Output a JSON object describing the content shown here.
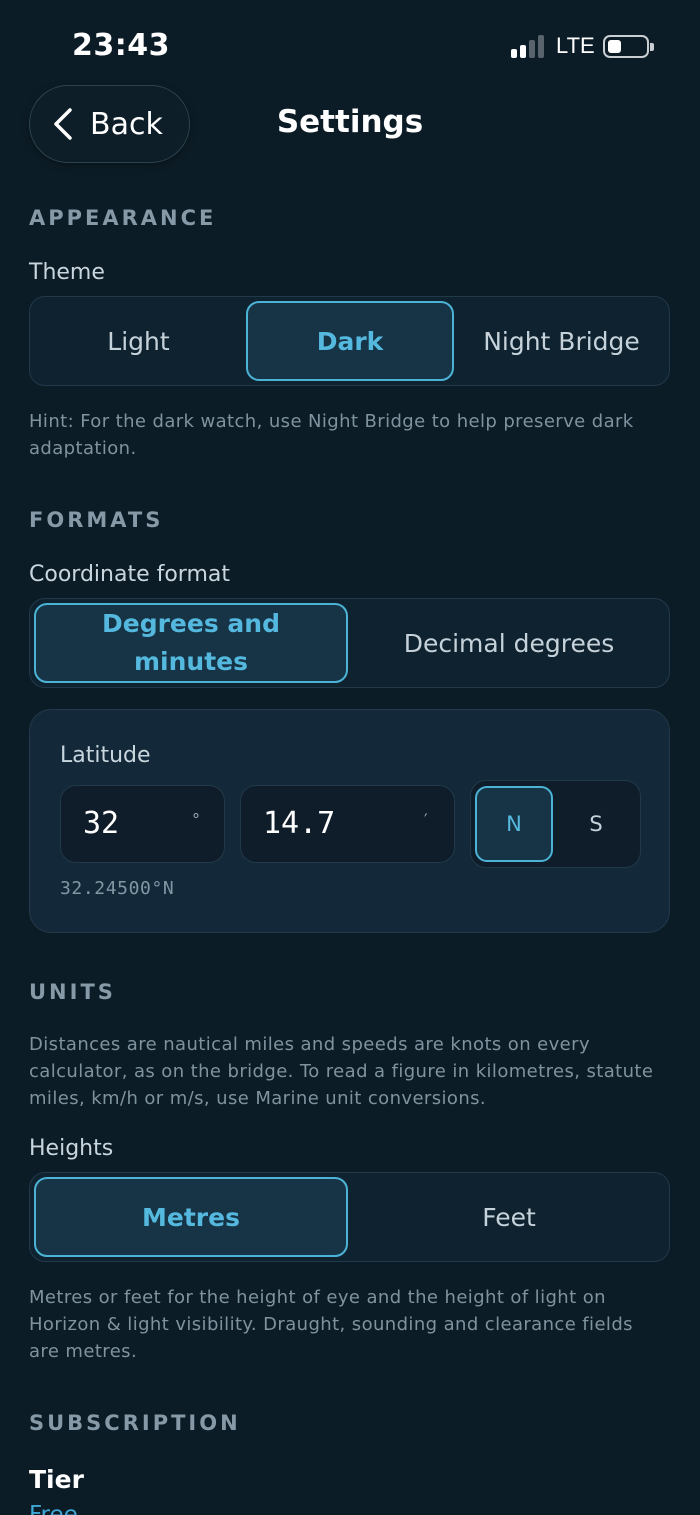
{
  "status_bar": {
    "time": "23:43",
    "network": "LTE",
    "icons": [
      "signal-icon",
      "battery-icon"
    ]
  },
  "header": {
    "back_label": "Back",
    "title": "Settings",
    "icons": [
      "chevron-left-icon"
    ]
  },
  "appearance": {
    "section": "APPEARANCE",
    "theme_label": "Theme",
    "options": [
      "Light",
      "Dark",
      "Night Bridge"
    ],
    "selected": "Dark",
    "hint": "Hint: For the dark watch, use Night Bridge to help preserve dark adaptation."
  },
  "formats": {
    "section": "FORMATS",
    "coordinate_label": "Coordinate format",
    "options": [
      "Degrees and minutes",
      "Decimal degrees"
    ],
    "selected": "Degrees and minutes",
    "latitude": {
      "label": "Latitude",
      "degrees": "32",
      "degrees_unit": "°",
      "minutes": "14.7",
      "minutes_unit": "′",
      "hemispheres": [
        "N",
        "S"
      ],
      "selected_hemisphere": "N",
      "readout": "32.24500°N"
    }
  },
  "units": {
    "section": "UNITS",
    "description": "Distances are nautical miles and speeds are knots on every calculator, as on the bridge. To read a figure in kilometres, statute miles, km/h or m/s, use Marine unit conversions.",
    "heights_label": "Heights",
    "options": [
      "Metres",
      "Feet"
    ],
    "selected": "Metres",
    "hint": "Metres or feet for the height of eye and the height of light on Horizon & light visibility. Draught, sounding and clearance fields are metres."
  },
  "subscription": {
    "section": "SUBSCRIPTION",
    "tier_label": "Tier",
    "tier_value": "Free"
  },
  "colors": {
    "background": "#0c1c26",
    "accent": "#4cb3d6",
    "card": "#13293a"
  }
}
